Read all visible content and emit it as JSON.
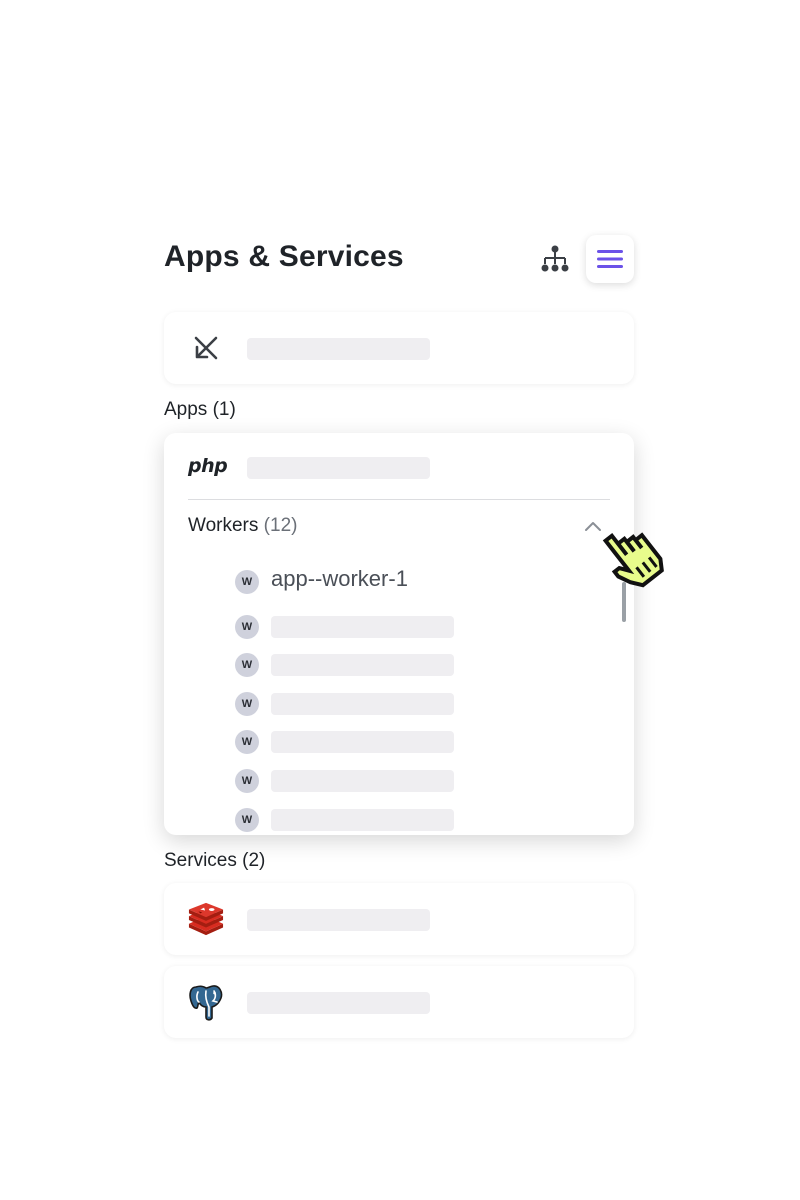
{
  "header": {
    "title": "Apps & Services",
    "tree_icon": "hierarchy-icon",
    "list_icon": "menu-list-icon",
    "accent": "#6b52e8"
  },
  "environment_row": {
    "icon": "collapse-arrows-icon"
  },
  "apps": {
    "label": "Apps (1)",
    "app": {
      "logo_text": "php",
      "workers_label": "Workers",
      "workers_count": "(12)",
      "workers": [
        {
          "badge": "W",
          "name": "app--worker-1"
        },
        {
          "badge": "W",
          "name": ""
        },
        {
          "badge": "W",
          "name": ""
        },
        {
          "badge": "W",
          "name": ""
        },
        {
          "badge": "W",
          "name": ""
        },
        {
          "badge": "W",
          "name": ""
        },
        {
          "badge": "W",
          "name": ""
        }
      ]
    }
  },
  "services": {
    "label": "Services (2)",
    "items": [
      {
        "icon": "redis-icon",
        "color": "#d82c20"
      },
      {
        "icon": "postgresql-icon",
        "color": "#336791"
      }
    ]
  },
  "colors": {
    "skeleton": "#efeef1",
    "cursor_fill": "#e8fb8c"
  }
}
